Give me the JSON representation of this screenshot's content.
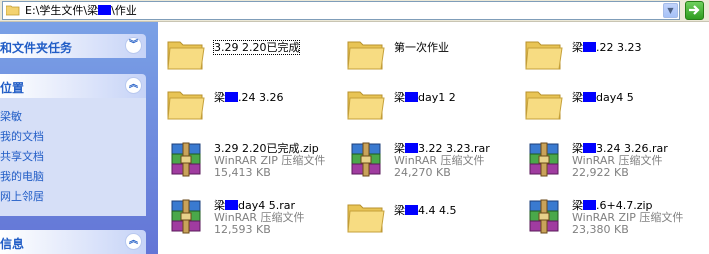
{
  "address": {
    "path_prefix": "E:\\学生文件\\梁",
    "path_suffix": "\\作业"
  },
  "sidebar": {
    "panel1_title": "和文件夹任务",
    "panel2_title": "位置",
    "places": [
      "梁敏",
      "我的文档",
      "共享文档",
      "我的电脑",
      "网上邻居"
    ],
    "panel3_title": "信息"
  },
  "items": [
    {
      "name": "3.29 2.20已完成",
      "type": "folder",
      "focus": true
    },
    {
      "name": "第一次作业",
      "type": "folder"
    },
    {
      "name_prefix": "梁",
      "name_suffix": ".22 3.23",
      "type": "folder"
    },
    {
      "name_prefix": "梁",
      "name_suffix": ".24 3.26",
      "type": "folder"
    },
    {
      "name_prefix": "梁",
      "name_suffix": "day1 2",
      "type": "folder"
    },
    {
      "name_prefix": "梁",
      "name_suffix": "day4 5",
      "type": "folder"
    },
    {
      "name": "3.29 2.20已完成.zip",
      "kind": "WinRAR ZIP 压缩文件",
      "size": "15,413 KB",
      "type": "archive"
    },
    {
      "name_prefix": "梁",
      "name_suffix": "3.22 3.23.rar",
      "kind": "WinRAR 压缩文件",
      "size": "24,270 KB",
      "type": "archive"
    },
    {
      "name_prefix": "梁",
      "name_suffix": "3.24 3.26.rar",
      "kind": "WinRAR 压缩文件",
      "size": "22,922 KB",
      "type": "archive"
    },
    {
      "name_prefix": "梁",
      "name_suffix": "day4 5.rar",
      "kind": "WinRAR 压缩文件",
      "size": "12,593 KB",
      "type": "archive"
    },
    {
      "name_prefix": "梁",
      "name_suffix": "4.4 4.5",
      "type": "folder"
    },
    {
      "name_prefix": "梁",
      "name_suffix": ".6+4.7.zip",
      "kind": "WinRAR ZIP 压缩文件",
      "size": "23,380 KB",
      "type": "archive"
    }
  ],
  "colors": {
    "redaction": "#0000ff",
    "link": "#215dc6",
    "panel_bg": "#d6dff7"
  }
}
